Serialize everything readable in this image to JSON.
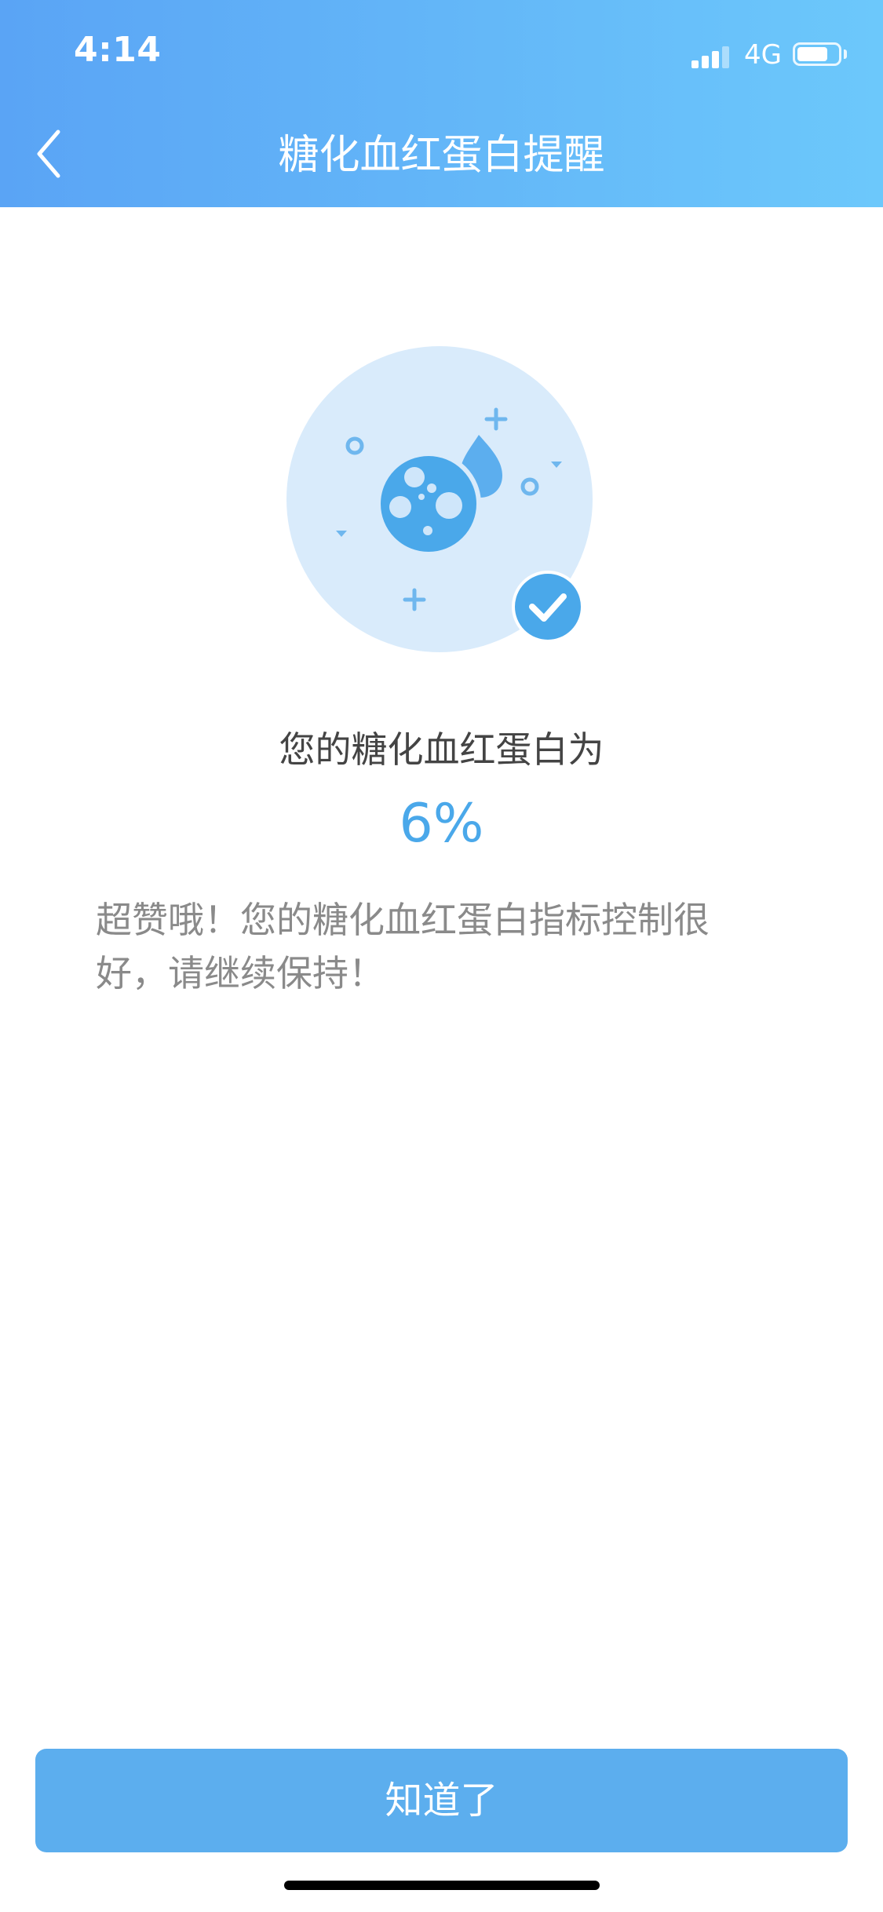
{
  "status_bar": {
    "time": "4:14",
    "network": "4G"
  },
  "nav": {
    "title": "糖化血红蛋白提醒",
    "back_icon": "chevron-left-icon"
  },
  "illustration": {
    "icon": "blood-cell-drop-illustration",
    "badge_icon": "check-badge-icon"
  },
  "result": {
    "label": "您的糖化血红蛋白为",
    "value": "6%",
    "message": "超赞哦！您的糖化血红蛋白指标控制很好，请继续保持！"
  },
  "footer": {
    "button_label": "知道了"
  },
  "colors": {
    "header_gradient_start": "#5aa4f5",
    "header_gradient_end": "#6cc8fb",
    "accent": "#4aa8ea",
    "button": "#5caeee"
  }
}
